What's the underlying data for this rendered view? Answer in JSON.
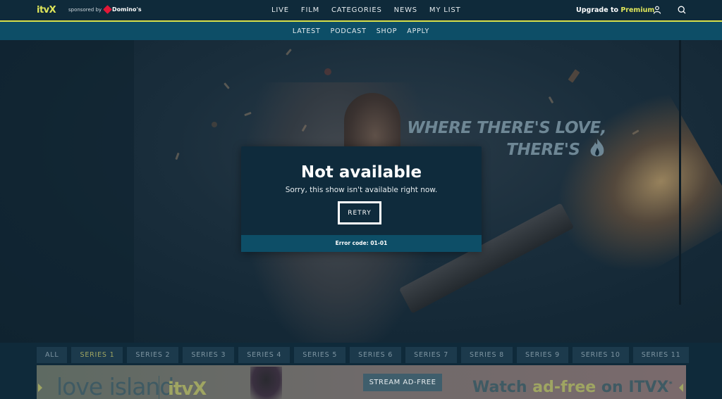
{
  "header": {
    "logo": "itvX",
    "sponsor_text": "sponsored by",
    "sponsor_brand": "Domino's",
    "nav": [
      "LIVE",
      "FILM",
      "CATEGORIES",
      "NEWS",
      "MY LIST"
    ],
    "upgrade_prefix": "Upgrade to ",
    "upgrade_premium": "Premium",
    "accent_color": "#dfe65a"
  },
  "subnav": [
    "LATEST",
    "PODCAST",
    "SHOP",
    "APPLY"
  ],
  "hero": {
    "tagline_line1": "WHERE THERE'S LOVE,",
    "tagline_line2": "THERE'S"
  },
  "modal": {
    "title": "Not available",
    "message": "Sorry, this show isn't available right now.",
    "retry_label": "RETRY",
    "error_code": "Error code: 01-01"
  },
  "series_tabs": {
    "active": "SERIES 1",
    "items": [
      "ALL",
      "SERIES 1",
      "SERIES 2",
      "SERIES 3",
      "SERIES 4",
      "SERIES 5",
      "SERIES 6",
      "SERIES 7",
      "SERIES 8",
      "SERIES 9",
      "SERIES 10",
      "SERIES 11"
    ]
  },
  "ad": {
    "logo_left": "love island",
    "logo_right": "itvX",
    "stream_label": "STREAM AD-FREE",
    "watch_prefix": "Watch ",
    "watch_highlight": "ad-free",
    "watch_suffix": " on ITVX",
    "watch_mark": "*"
  }
}
